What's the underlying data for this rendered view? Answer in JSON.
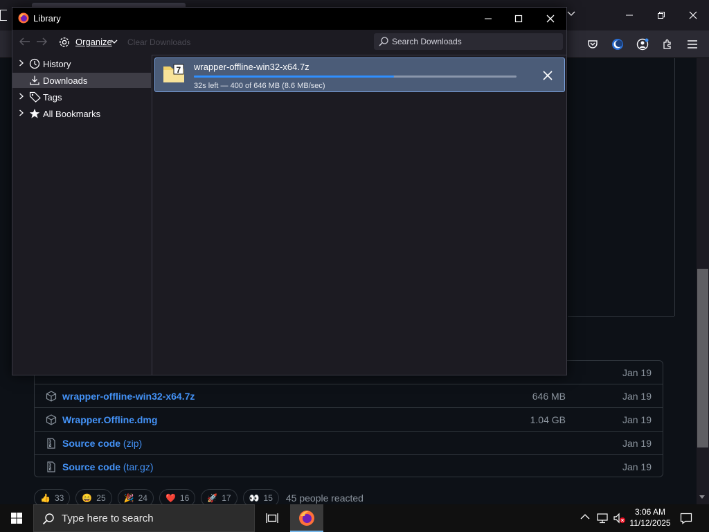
{
  "library": {
    "title": "Library",
    "organize_label": "Organize",
    "clear_downloads_label": "Clear Downloads",
    "search_placeholder": "Search Downloads",
    "sidebar": [
      {
        "label": "History",
        "icon": "clock-icon"
      },
      {
        "label": "Downloads",
        "icon": "download-icon",
        "selected": true
      },
      {
        "label": "Tags",
        "icon": "tag-icon"
      },
      {
        "label": "All Bookmarks",
        "icon": "star-icon"
      }
    ],
    "download": {
      "filename": "wrapper-offline-win32-x64.7z",
      "status": "32s left — 400 of 646 MB (8.6 MB/sec)",
      "progress": 0.62
    }
  },
  "assets": {
    "rows": [
      {
        "name": "wrapper-offline-win32-x64.7z",
        "sub": "",
        "size": "646 MB",
        "date": "Jan 19",
        "icon": "package-icon"
      },
      {
        "name": "Wrapper.Offline.dmg",
        "sub": "",
        "size": "1.04 GB",
        "date": "Jan 19",
        "icon": "package-icon"
      },
      {
        "name": "Source code",
        "sub": "(zip)",
        "size": "",
        "date": "Jan 19",
        "icon": "file-zip-icon"
      },
      {
        "name": "Source code",
        "sub": "(tar.gz)",
        "size": "",
        "date": "Jan 19",
        "icon": "file-zip-icon"
      }
    ],
    "partial_row": {
      "date": "Jan 19"
    }
  },
  "reactions": {
    "items": [
      {
        "emoji": "👍",
        "count": "33"
      },
      {
        "emoji": "😄",
        "count": "25"
      },
      {
        "emoji": "🎉",
        "count": "24"
      },
      {
        "emoji": "❤️",
        "count": "16"
      },
      {
        "emoji": "🚀",
        "count": "17"
      },
      {
        "emoji": "👀",
        "count": "15"
      }
    ],
    "summary": "45 people reacted"
  },
  "taskbar": {
    "search_placeholder": "Type here to search",
    "time": "3:06 AM",
    "date": "11/12/2025"
  },
  "colors": {
    "link": "#4493f8",
    "progress": "#2f8fff",
    "selection": "#4b5c78"
  }
}
